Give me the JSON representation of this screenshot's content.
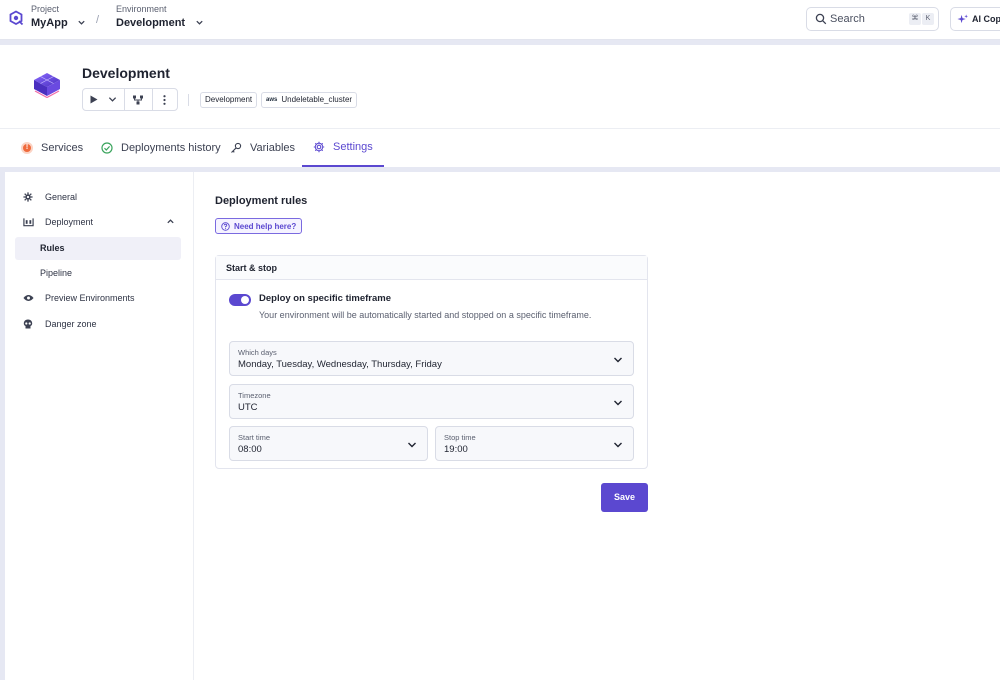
{
  "topbar": {
    "project_label": "Project",
    "project_value": "MyApp",
    "separator": "/",
    "environment_label": "Environment",
    "environment_value": "Development",
    "search_placeholder": "Search",
    "kbd_cmd": "⌘",
    "kbd_k": "K",
    "copilot_label": "AI Copil"
  },
  "header": {
    "title": "Development",
    "tags": [
      {
        "label": "Development"
      },
      {
        "prefix": "aws",
        "label": "Undeletable_cluster"
      }
    ],
    "tabs": [
      {
        "label": "Services",
        "status": "!"
      },
      {
        "label": "Deployments history"
      },
      {
        "label": "Variables"
      },
      {
        "label": "Settings",
        "active": true
      }
    ]
  },
  "sidebar": {
    "items": [
      {
        "label": "General",
        "icon": "gear-icon"
      },
      {
        "label": "Deployment",
        "icon": "deployment-icon"
      },
      {
        "label": "Rules",
        "active": true
      },
      {
        "label": "Pipeline"
      },
      {
        "label": "Preview Environments",
        "icon": "eye-icon"
      },
      {
        "label": "Danger zone",
        "icon": "skull-icon"
      }
    ]
  },
  "main": {
    "title": "Deployment rules",
    "help_label": "Need help here?",
    "card_title": "Start & stop",
    "toggle_label": "Deploy on specific timeframe",
    "toggle_on": true,
    "toggle_desc": "Your environment will be automatically started and stopped on a specific timeframe.",
    "fields": {
      "days_label": "Which days",
      "days_value": "Monday, Tuesday, Wednesday, Thursday, Friday",
      "timezone_label": "Timezone",
      "timezone_value": "UTC",
      "start_label": "Start time",
      "start_value": "08:00",
      "stop_label": "Stop time",
      "stop_value": "19:00"
    },
    "save_label": "Save"
  },
  "colors": {
    "accent": "#5b48d0",
    "error": "#ef6a3c",
    "success": "#3aa45d"
  }
}
